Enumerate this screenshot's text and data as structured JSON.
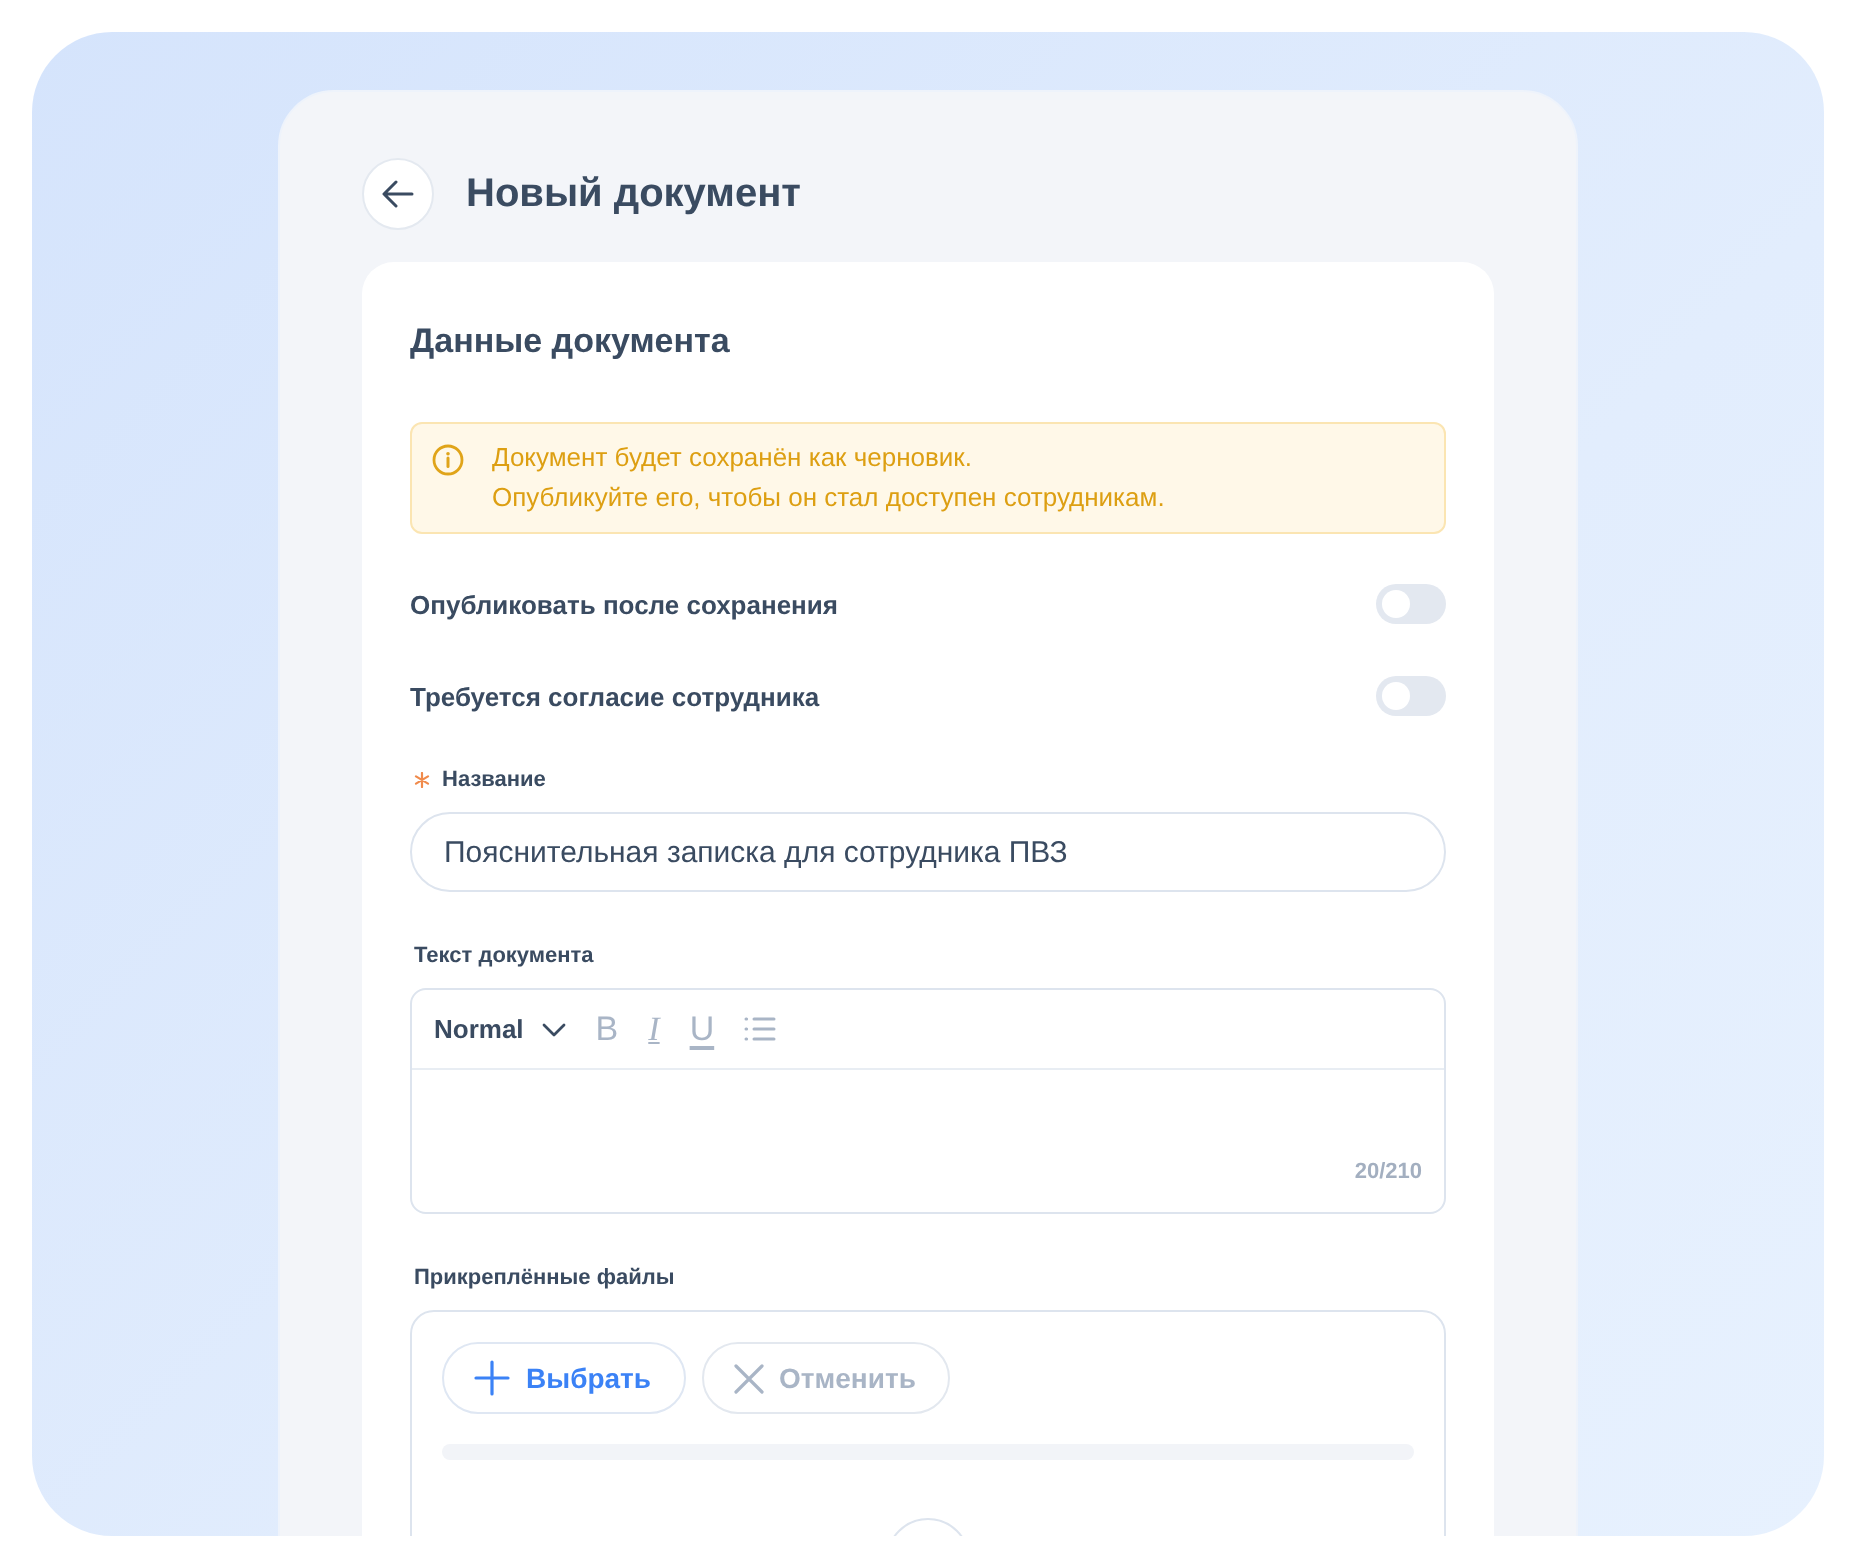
{
  "page": {
    "title": "Новый документ"
  },
  "card": {
    "title": "Данные документа",
    "notice": {
      "text": "Документ будет сохранён как черновик.\nОпубликуйте его, чтобы он стал доступен сотрудникам."
    },
    "toggles": [
      {
        "label": "Опубликовать после сохранения",
        "on": false
      },
      {
        "label": "Требуется согласие сотрудника",
        "on": false
      }
    ],
    "name_field": {
      "label": "Название",
      "required": true,
      "value": "Пояснительная записка для сотрудника ПВЗ"
    },
    "editor": {
      "label": "Текст документа",
      "format": "Normal",
      "tools": [
        {
          "kind": "bold",
          "glyph": "B",
          "disabled": true
        },
        {
          "kind": "italic",
          "glyph": "I",
          "disabled": true
        },
        {
          "kind": "underline",
          "glyph": "U",
          "disabled": true
        },
        {
          "kind": "list",
          "disabled": true
        }
      ],
      "counter": "20/210"
    },
    "attachments": {
      "label": "Прикреплённые файлы",
      "buttons": [
        {
          "kind": "add",
          "label": "Выбрать",
          "disabled": false
        },
        {
          "kind": "cancel",
          "label": "Отменить",
          "disabled": true
        }
      ],
      "progress": {
        "level": 0
      }
    }
  }
}
